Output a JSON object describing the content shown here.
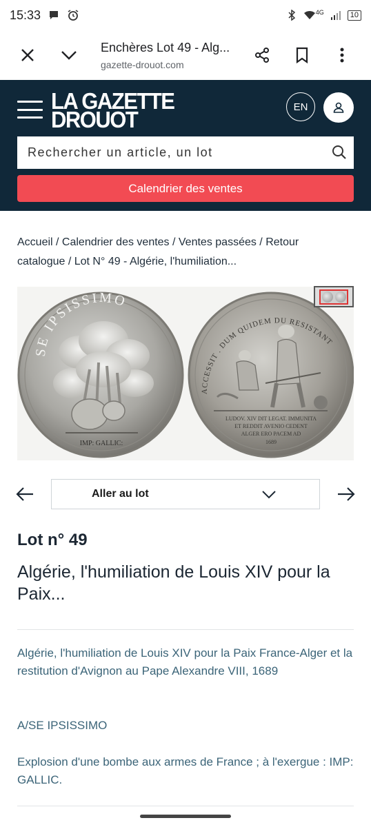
{
  "status_bar": {
    "time": "15:33",
    "network": "4G",
    "battery": "10"
  },
  "browser": {
    "title": "Enchères Lot 49 - Alg...",
    "url": "gazette-drouot.com"
  },
  "header": {
    "logo_line1": "LA GAZETTE",
    "logo_line2": "DROUOT",
    "lang_button": "EN",
    "search_placeholder": "Rechercher un article, un lot",
    "calendar_button": "Calendrier des ventes",
    "brand_color": "#102839",
    "accent_color": "#f24b53"
  },
  "breadcrumb": {
    "text": "Accueil / Calendrier des ventes / Ventes passées / Retour catalogue / Lot N°  49 - Algérie, l'humiliation..."
  },
  "image": {
    "left_coin_legend": "SE IPSISSIMO",
    "left_coin_exergue": "IMP: GALLIC:",
    "right_coin_legend": "ACCESSIT . DUM QUIDEM DU RESISTANT",
    "right_coin_exergue_1": "LUDOV. XIV DIT LEGAT. IMMUNITA",
    "right_coin_exergue_2": "ET REDDIT AVENIO CEDENT",
    "right_coin_exergue_3": "ALGER ERO PACEM AD",
    "right_coin_exergue_4": "1689"
  },
  "navigation": {
    "select_label": "Aller au lot"
  },
  "lot": {
    "number": "Lot n° 49",
    "title": "Algérie, l'humiliation de Louis XIV pour la Paix...",
    "description_1": "Algérie, l'humiliation de Louis XIV pour la Paix France-Alger et la restitution d'Avignon au Pape Alexandre VIII, 1689",
    "description_2": "A/SE IPSISSIMO",
    "description_3": "Explosion d'une bombe aux armes de France ; à l'exergue : IMP: GALLIC."
  }
}
